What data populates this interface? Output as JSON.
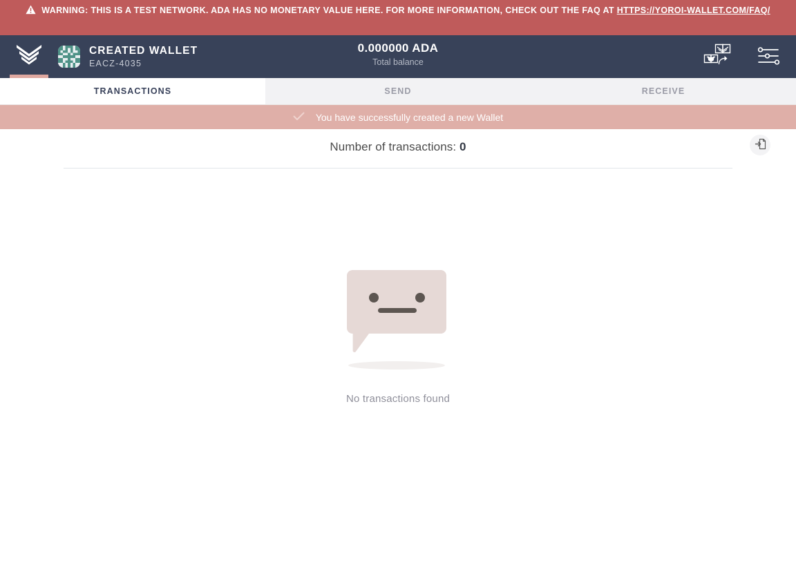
{
  "warning_banner": {
    "icon": "warning-triangle-icon",
    "text": "WARNING: THIS IS A TEST NETWORK. ADA HAS NO MONETARY VALUE HERE. FOR MORE INFORMATION, CHECK OUT THE FAQ AT ",
    "link_text": "HTTPS://YOROI-WALLET.COM/FAQ/",
    "background": "#bf5b5b"
  },
  "header": {
    "logo_icon": "yoroi-chevron-logo-icon",
    "wallet_avatar_icon": "wallet-identicon-avatar",
    "wallet_name": "CREATED WALLET",
    "wallet_plate": "EACZ-4035",
    "balance_amount": "0.000000 ADA",
    "balance_label": "Total balance",
    "background": "#384259",
    "accent": "#dfa8a0",
    "actions": [
      {
        "icon": "switch-wallet-icon",
        "label": "Switch wallet"
      },
      {
        "icon": "settings-sliders-icon",
        "label": "Settings"
      }
    ]
  },
  "tabs": [
    {
      "label": "TRANSACTIONS",
      "active": true
    },
    {
      "label": "SEND",
      "active": false
    },
    {
      "label": "RECEIVE",
      "active": false
    }
  ],
  "notification": {
    "icon": "check-icon",
    "message": "You have successfully created a new Wallet",
    "background": "#dfafa8"
  },
  "summary": {
    "transactions_label": "Number of transactions:",
    "transactions_count": "0",
    "export_icon": "export-file-icon"
  },
  "empty_state": {
    "illustration_icon": "neutral-face-speech-bubble-icon",
    "message": "No transactions found"
  }
}
